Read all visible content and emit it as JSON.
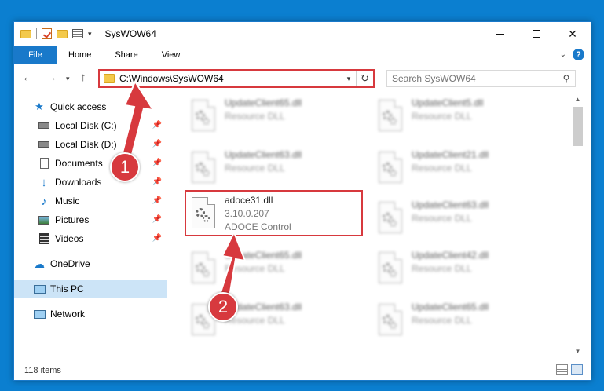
{
  "window": {
    "title": "SysWOW64"
  },
  "ribbon": {
    "tabs": [
      "File",
      "Home",
      "Share",
      "View"
    ],
    "help": "?"
  },
  "address": {
    "path": "C:\\Windows\\SysWOW64"
  },
  "search": {
    "placeholder": "Search SysWOW64"
  },
  "nav": {
    "items": [
      {
        "label": "Quick access",
        "icon": "star-icon",
        "pinned": false
      },
      {
        "label": "Local Disk (C:)",
        "icon": "drive-icon",
        "pinned": true
      },
      {
        "label": "Local Disk (D:)",
        "icon": "drive-icon",
        "pinned": true
      },
      {
        "label": "Documents",
        "icon": "documents-icon",
        "pinned": true
      },
      {
        "label": "Downloads",
        "icon": "download-icon",
        "pinned": true
      },
      {
        "label": "Music",
        "icon": "music-icon",
        "pinned": true
      },
      {
        "label": "Pictures",
        "icon": "pictures-icon",
        "pinned": true
      },
      {
        "label": "Videos",
        "icon": "videos-icon",
        "pinned": true
      },
      {
        "label": "OneDrive",
        "icon": "cloud-icon",
        "pinned": false
      },
      {
        "label": "This PC",
        "icon": "computer-icon",
        "pinned": false,
        "selected": true
      },
      {
        "label": "Network",
        "icon": "network-icon",
        "pinned": false
      }
    ]
  },
  "files": {
    "left": [
      {
        "name": "UpdateClient65.dll",
        "desc": "Resource DLL"
      },
      {
        "name": "UpdateClient63.dll",
        "desc": "Resource DLL"
      },
      {
        "name": "adoce31.dll",
        "version": "3.10.0.207",
        "desc": "ADOCE Control",
        "highlighted": true
      },
      {
        "name": "UpdateClient65.dll",
        "desc": "Resource DLL"
      },
      {
        "name": "UpdateClient63.dll",
        "desc": "Resource DLL"
      }
    ],
    "right": [
      {
        "name": "UpdateClient5.dll",
        "desc": "Resource DLL"
      },
      {
        "name": "UpdateClient21.dll",
        "desc": "Resource DLL"
      },
      {
        "name": "UpdateClient63.dll",
        "desc": "Resource DLL"
      },
      {
        "name": "UpdateClient42.dll",
        "desc": "Resource DLL"
      },
      {
        "name": "UpdateClient65.dll",
        "desc": "Resource DLL"
      }
    ]
  },
  "status": {
    "count": "118 items"
  },
  "annotations": {
    "badge1": "1",
    "badge2": "2",
    "accent": "#d7393e"
  },
  "colors": {
    "accent": "#1979ca",
    "selection": "#cce4f7"
  }
}
